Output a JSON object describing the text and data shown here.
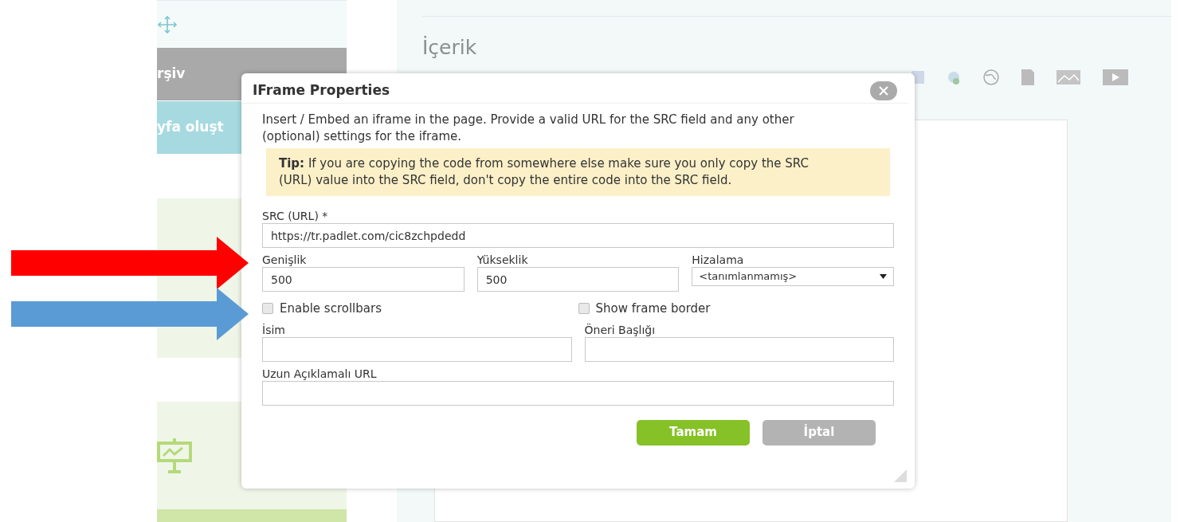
{
  "sidebar": {
    "items": [
      {
        "label": "rşiv",
        "kind": "gray"
      },
      {
        "label": "yfa oluşt",
        "kind": "teal"
      }
    ]
  },
  "editor": {
    "title": "İçerik"
  },
  "dialog": {
    "title": "IFrame Properties",
    "intro": "Insert / Embed an iframe in the page. Provide a valid URL for the SRC field and any other (optional) settings for the iframe.",
    "tip": "**Tip:** If you are copying the code from somewhere else make sure you only copy the SRC (URL) value into the SRC field, don't copy the entire code into the SRC field.",
    "rows": [
      {
        "kind": "fields",
        "fields": [
          {
            "label": "SRC (URL) *",
            "kind": "text",
            "value": "https://tr.padlet.com/cic8zchpdedd"
          }
        ]
      },
      {
        "kind": "fields",
        "fields": [
          {
            "label": "Genişlik",
            "kind": "text",
            "value": "500"
          },
          {
            "label": "Yükseklik",
            "kind": "text",
            "value": "500"
          },
          {
            "label": "Hizalama",
            "kind": "select",
            "value": "<tanımlanmamış>"
          }
        ]
      },
      {
        "kind": "checks",
        "checkboxes": [
          {
            "label": "Enable scrollbars",
            "checked": false
          },
          {
            "label": "Show frame border",
            "checked": false
          }
        ]
      },
      {
        "kind": "fields",
        "fields": [
          {
            "label": "İsim",
            "kind": "text"
          },
          {
            "label": "Öneri Başlığı",
            "kind": "text"
          }
        ]
      },
      {
        "kind": "fields",
        "fields": [
          {
            "label": "Uzun Açıklamalı URL",
            "kind": "text"
          }
        ]
      }
    ],
    "buttons": [
      {
        "label": "Tamam",
        "kind": "primary"
      },
      {
        "label": "İptal",
        "kind": "secondary"
      }
    ]
  },
  "arrows": [
    {
      "color": "#ff0000"
    },
    {
      "color": "#5b9bd5"
    }
  ]
}
